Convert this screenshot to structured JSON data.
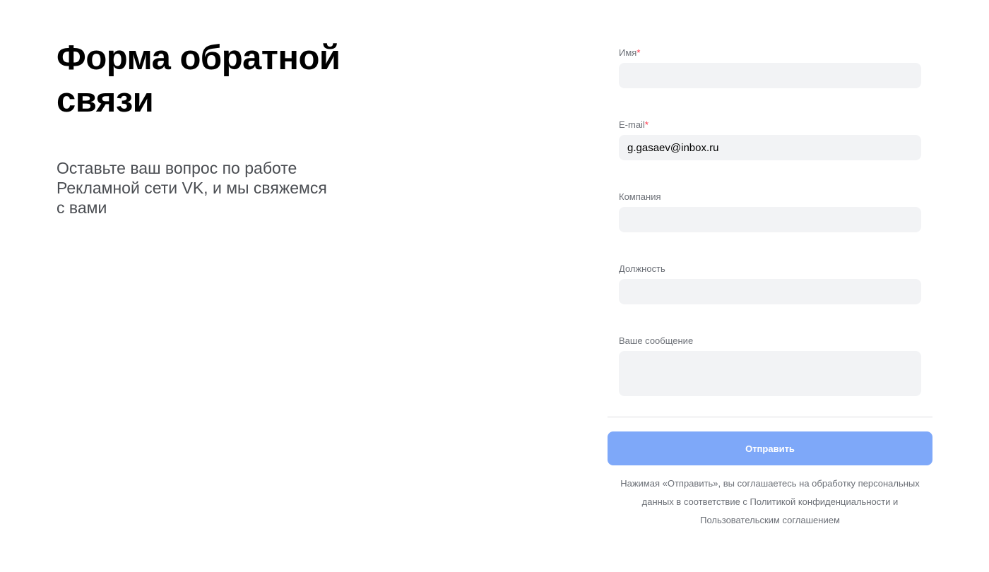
{
  "intro": {
    "title_lines": [
      "Форма обратной",
      "связи"
    ],
    "subtitle_lines": [
      "Оставьте ваш вопрос по работе",
      "Рекламной сети VK, и мы свяжемся",
      "с вами"
    ]
  },
  "form": {
    "fields": {
      "name": {
        "label": "Имя",
        "required_mark": "*",
        "value": ""
      },
      "email": {
        "label": "E-mail",
        "required_mark": "*",
        "value": "g.gasaev@inbox.ru"
      },
      "company": {
        "label": "Компания",
        "value": ""
      },
      "position": {
        "label": "Должность",
        "value": ""
      },
      "message": {
        "label": "Ваше сообщение",
        "value": ""
      }
    },
    "submit_label": "Отправить",
    "consent_lines": [
      "Нажимая «Отправить», вы соглашаетесь на обработку персональных",
      "данных в соответствие с Политикой конфиденциальности и",
      "Пользовательским соглашением"
    ]
  },
  "colors": {
    "required_mark": "#ff3347",
    "submit_background": "#7ea8f9",
    "input_background": "#f2f3f5"
  }
}
